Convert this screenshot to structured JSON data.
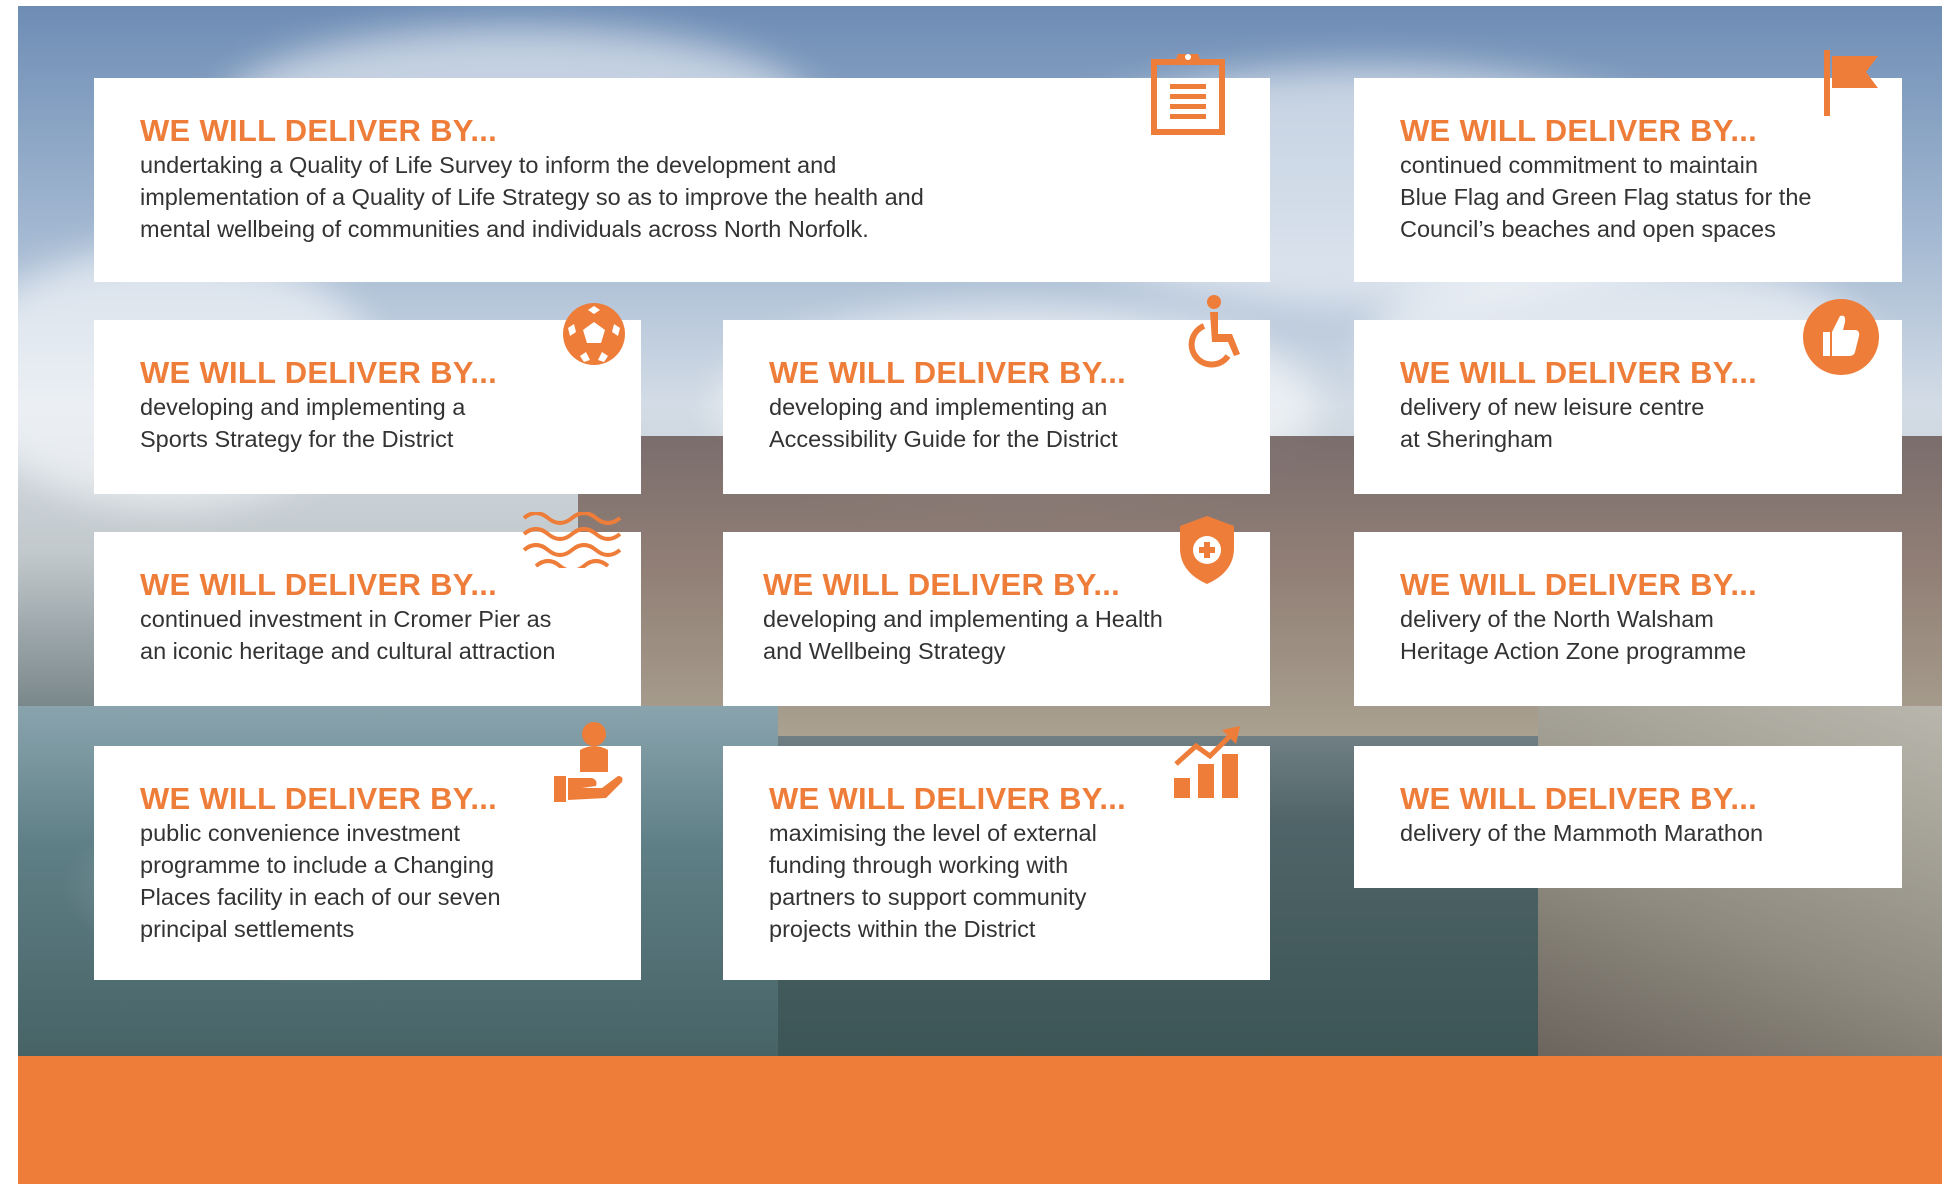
{
  "cards": [
    {
      "heading": "WE WILL DELIVER BY...",
      "lines": [
        "undertaking a Quality of Life Survey to inform the development and",
        "implementation of a Quality of Life Strategy so as to improve the health and",
        "mental wellbeing of communities and individuals across North Norfolk."
      ],
      "icon": "clipboard-icon"
    },
    {
      "heading": "WE WILL DELIVER BY...",
      "lines": [
        "continued commitment to maintain",
        "Blue Flag and Green Flag status for the",
        "Council’s beaches and open spaces"
      ],
      "icon": "flag-icon"
    },
    {
      "heading": "WE WILL DELIVER BY...",
      "lines": [
        "developing and implementing a",
        "Sports Strategy for the District"
      ],
      "icon": "football-icon"
    },
    {
      "heading": "WE WILL DELIVER BY...",
      "lines": [
        "developing and implementing an",
        "Accessibility Guide for the District"
      ],
      "icon": "wheelchair-icon"
    },
    {
      "heading": "WE WILL DELIVER BY...",
      "lines": [
        "delivery of new leisure centre",
        "at Sheringham"
      ],
      "icon": "thumbs-up-icon"
    },
    {
      "heading": "WE WILL DELIVER BY...",
      "lines": [
        "continued investment in Cromer Pier as",
        "an iconic heritage and cultural attraction"
      ],
      "icon": "waves-icon"
    },
    {
      "heading": "WE WILL DELIVER BY...",
      "lines": [
        "developing and implementing a Health",
        "and Wellbeing Strategy"
      ],
      "icon": "health-shield-icon"
    },
    {
      "heading": "WE WILL DELIVER BY...",
      "lines": [
        "delivery of the North Walsham",
        "Heritage Action Zone programme"
      ],
      "icon": ""
    },
    {
      "heading": "WE WILL DELIVER BY...",
      "lines": [
        "public convenience investment",
        "programme to include a Changing",
        "Places facility in each of our seven",
        "principal settlements"
      ],
      "icon": "hand-person-icon"
    },
    {
      "heading": "WE WILL DELIVER BY...",
      "lines": [
        "maximising the level of external",
        "funding through working with",
        "partners to support community",
        "projects within the District"
      ],
      "icon": "growth-chart-icon"
    },
    {
      "heading": "WE WILL DELIVER BY...",
      "lines": [
        "delivery of the Mammoth Marathon"
      ],
      "icon": ""
    }
  ],
  "colors": {
    "accent": "#ef7d3a",
    "text": "#333333",
    "card": "#ffffff"
  }
}
